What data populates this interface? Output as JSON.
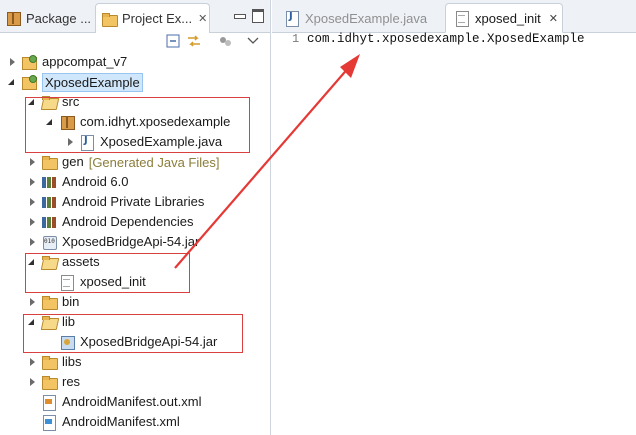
{
  "left_view": {
    "tabs": [
      {
        "label": "Package ...",
        "active": false
      },
      {
        "label": "Project Ex...",
        "active": true,
        "close": "✕"
      }
    ],
    "toolbar_icons": [
      "collapse-all-icon",
      "link-with-editor-icon",
      "view-options-icon",
      "view-menu-icon"
    ],
    "tree": {
      "appcompat": "appcompat_v7",
      "project": "XposedExample",
      "src": "src",
      "package": "com.idhyt.xposedexample",
      "java_file": "XposedExample.java",
      "gen": "gen",
      "gen_note": "[Generated Java Files]",
      "android": "Android 6.0",
      "private_libs": "Android Private Libraries",
      "dependencies": "Android Dependencies",
      "bridge_jar": "XposedBridgeApi-54.jar",
      "assets": "assets",
      "xposed_init": "xposed_init",
      "bin": "bin",
      "lib": "lib",
      "lib_jar": "XposedBridgeApi-54.jar",
      "libs": "libs",
      "res": "res",
      "manifest_out": "AndroidManifest.out.xml",
      "manifest": "AndroidManifest.xml"
    }
  },
  "editor": {
    "tabs": [
      {
        "label": "XposedExample.java",
        "active": false
      },
      {
        "label": "xposed_init",
        "active": true,
        "close": "✕"
      }
    ],
    "line_number": "1",
    "code_line": "com.idhyt.xposedexample.XposedExample"
  },
  "colors": {
    "annotation": "#e53935",
    "selection": "#cfe6fb"
  }
}
